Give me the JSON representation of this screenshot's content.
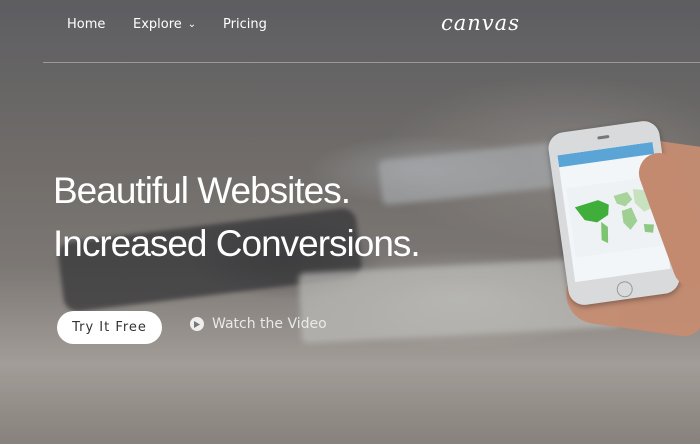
{
  "nav": {
    "home": "Home",
    "explore": "Explore",
    "pricing": "Pricing",
    "logo": "canvas"
  },
  "hero": {
    "headline_line1": "Beautiful Websites.",
    "headline_line2": "Increased Conversions.",
    "cta_primary": "Try It Free",
    "cta_secondary": "Watch the Video"
  },
  "icons": {
    "explore_dropdown": "chevron-down-icon",
    "video": "play-icon"
  },
  "colors": {
    "text": "#ffffff",
    "button_bg": "#ffffff",
    "button_text": "#333333"
  }
}
